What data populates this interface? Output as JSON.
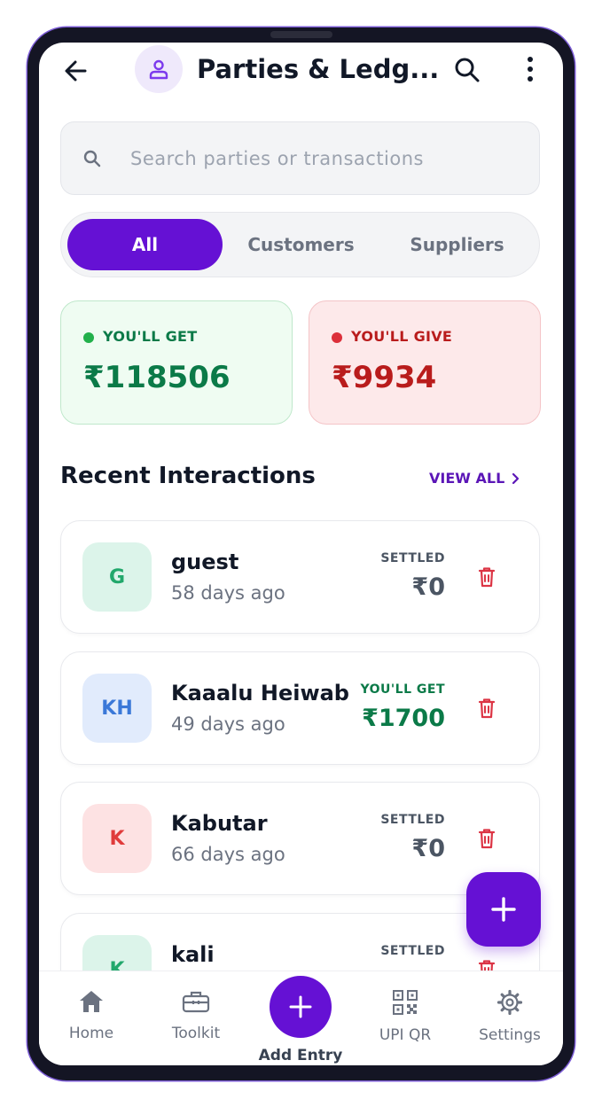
{
  "header": {
    "title": "Parties & Ledg...",
    "back_icon": "arrow-left-icon",
    "avatar_icon": "user-icon",
    "search_icon": "search-icon",
    "menu_icon": "more-vertical-icon"
  },
  "search": {
    "placeholder": "Search parties or transactions",
    "value": ""
  },
  "filter_tabs": [
    {
      "label": "All",
      "active": true
    },
    {
      "label": "Customers",
      "active": false
    },
    {
      "label": "Suppliers",
      "active": false
    }
  ],
  "summary": {
    "get": {
      "label": "YOU'LL GET",
      "amount": "₹118506"
    },
    "give": {
      "label": "YOU'LL GIVE",
      "amount": "₹9934"
    }
  },
  "recent": {
    "title": "Recent Interactions",
    "view_all": "VIEW ALL",
    "items": [
      {
        "initials": "G",
        "name": "guest",
        "ago": "58 days ago",
        "status": "SETTLED",
        "amount": "₹0"
      },
      {
        "initials": "KH",
        "name": "Kaaalu Heiwab",
        "ago": "49 days ago",
        "status": "YOU'LL GET",
        "amount": "₹1700"
      },
      {
        "initials": "K",
        "name": "Kabutar",
        "ago": "66 days ago",
        "status": "SETTLED",
        "amount": "₹0"
      },
      {
        "initials": "K",
        "name": "kali",
        "ago": "",
        "status": "SETTLED",
        "amount": ""
      }
    ]
  },
  "bottom_nav": {
    "home": "Home",
    "toolkit": "Toolkit",
    "add_entry": "Add Entry",
    "upi_qr": "UPI QR",
    "settings": "Settings"
  },
  "colors": {
    "accent": "#6511d4",
    "positive": "#0b7a48",
    "negative": "#b91c1c"
  }
}
